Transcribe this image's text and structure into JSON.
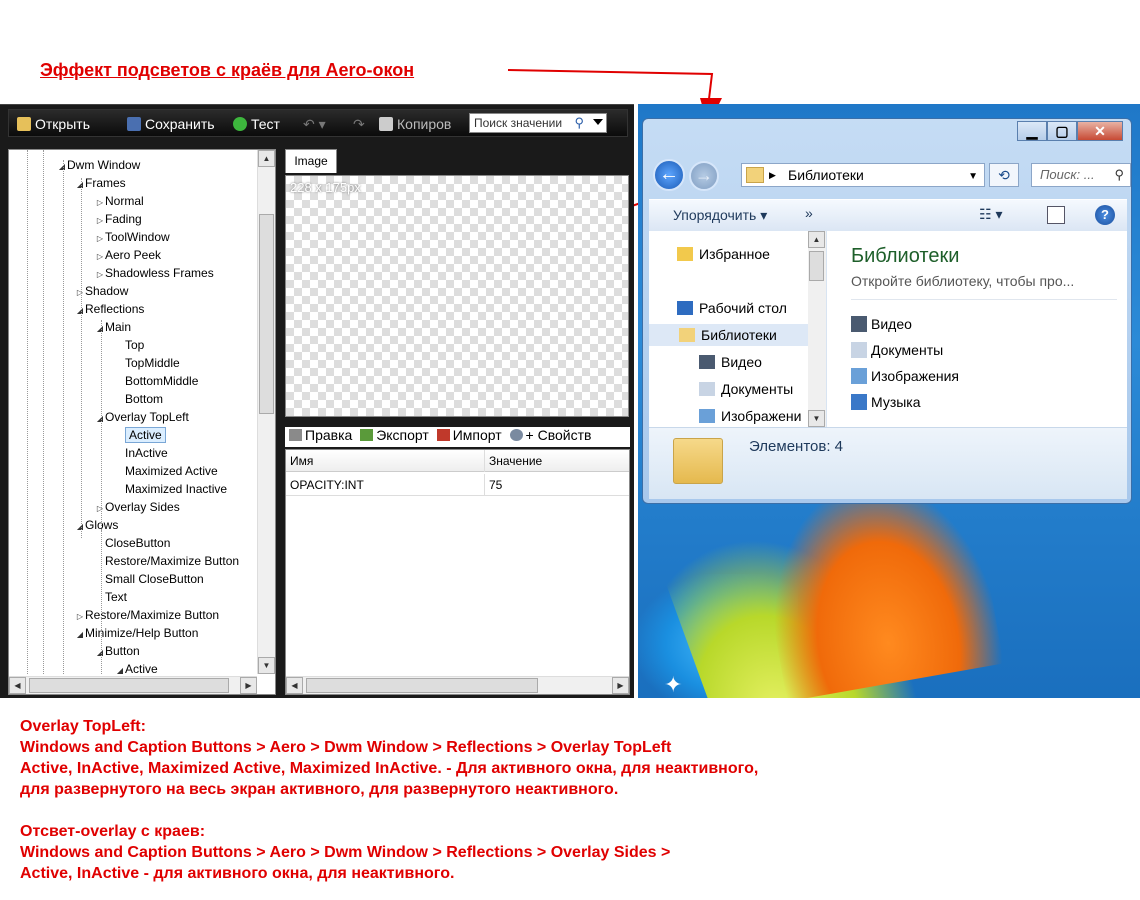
{
  "heading": "Эффект подсветов с краёв для Aero-окон",
  "editor": {
    "toolbar": {
      "open": "Открыть",
      "save": "Сохранить",
      "test": "Тест",
      "copy": "Копиров",
      "search_placeholder": "Поиск значении"
    },
    "tree": [
      {
        "label": "Dwm Window",
        "level": 3,
        "exp": "◢"
      },
      {
        "label": "Frames",
        "level": 4,
        "exp": "◢"
      },
      {
        "label": "Normal",
        "level": 5,
        "exp": "▷"
      },
      {
        "label": "Fading",
        "level": 5,
        "exp": "▷"
      },
      {
        "label": "ToolWindow",
        "level": 5,
        "exp": "▷"
      },
      {
        "label": "Aero Peek",
        "level": 5,
        "exp": "▷"
      },
      {
        "label": "Shadowless Frames",
        "level": 5,
        "exp": "▷"
      },
      {
        "label": "Shadow",
        "level": 4,
        "exp": "▷"
      },
      {
        "label": "Reflections",
        "level": 4,
        "exp": "◢"
      },
      {
        "label": "Main",
        "level": 5,
        "exp": "◢"
      },
      {
        "label": "Top",
        "level": 6,
        "exp": ""
      },
      {
        "label": "TopMiddle",
        "level": 6,
        "exp": ""
      },
      {
        "label": "BottomMiddle",
        "level": 6,
        "exp": ""
      },
      {
        "label": "Bottom",
        "level": 6,
        "exp": ""
      },
      {
        "label": "Overlay TopLeft",
        "level": 5,
        "exp": "◢"
      },
      {
        "label": "Active",
        "level": 6,
        "exp": "",
        "selected": true
      },
      {
        "label": "InActive",
        "level": 6,
        "exp": ""
      },
      {
        "label": "Maximized Active",
        "level": 6,
        "exp": ""
      },
      {
        "label": "Maximized Inactive",
        "level": 6,
        "exp": ""
      },
      {
        "label": "Overlay Sides",
        "level": 5,
        "exp": "▷"
      },
      {
        "label": "Glows",
        "level": 4,
        "exp": "◢"
      },
      {
        "label": "CloseButton",
        "level": 5,
        "exp": ""
      },
      {
        "label": "Restore/Maximize Button",
        "level": 5,
        "exp": ""
      },
      {
        "label": "Small CloseButton",
        "level": 5,
        "exp": ""
      },
      {
        "label": "Text",
        "level": 5,
        "exp": ""
      },
      {
        "label": "Restore/Maximize Button",
        "level": 4,
        "exp": "▷"
      },
      {
        "label": "Minimize/Help Button",
        "level": 4,
        "exp": "◢"
      },
      {
        "label": "Button",
        "level": 5,
        "exp": "◢"
      },
      {
        "label": "Active",
        "level": 6,
        "exp": "◢"
      }
    ],
    "image_tab": "Image",
    "image_size": "228 x 175px",
    "props_toolbar": {
      "edit": "Правка",
      "export": "Экспорт",
      "import": "Импорт",
      "props": "+ Свойств"
    },
    "grid": {
      "col_name": "Имя",
      "col_value": "Значение",
      "rows": [
        {
          "name": "OPACITY:INT",
          "value": "75"
        }
      ]
    }
  },
  "explorer": {
    "address": "Библиотеки",
    "search_placeholder": "Поиск: ...",
    "organize": "Упорядочить ▾",
    "more": "»",
    "nav": [
      {
        "label": "Избранное",
        "icon": "star-icon"
      },
      {
        "label": "Рабочий стол",
        "icon": "desktop-icon"
      },
      {
        "label": "Библиотеки",
        "icon": "library-icon",
        "selected": true
      },
      {
        "label": "Видео",
        "icon": "video-icon"
      },
      {
        "label": "Документы",
        "icon": "documents-icon"
      },
      {
        "label": "Изображени",
        "icon": "pictures-icon"
      }
    ],
    "title": "Библиотеки",
    "subtitle": "Откройте библиотеку, чтобы про...",
    "libraries": [
      {
        "label": "Видео",
        "icon": "video-icon"
      },
      {
        "label": "Документы",
        "icon": "documents-icon"
      },
      {
        "label": "Изображения",
        "icon": "pictures-icon"
      },
      {
        "label": "Музыка",
        "icon": "music-icon"
      }
    ],
    "status": "Элементов: 4"
  },
  "notes": [
    "Overlay TopLeft:",
    "Windows and Caption Buttons > Aero > Dwm Window > Reflections > Overlay TopLeft",
    "Active, InActive, Maximized Active, Maximized InActive. - Для активного окна, для неактивного,",
    "для развернутого на весь экран активного, для развернутого неактивного.",
    "",
    "Отсвет-overlay с краев:",
    "Windows and Caption Buttons > Aero > Dwm Window > Reflections > Overlay Sides >",
    "Active, InActive - для активного окна, для неактивного."
  ],
  "colors": {
    "annotation_red": "#e00000",
    "toolbar_bg": "#111111",
    "library_title": "#1e5f2a"
  }
}
